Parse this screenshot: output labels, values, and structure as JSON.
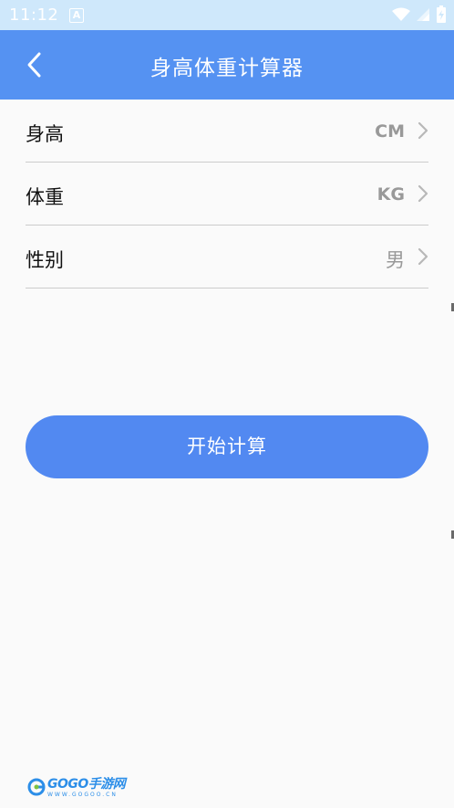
{
  "status_bar": {
    "time": "11:12",
    "notification_letter": "A"
  },
  "app_bar": {
    "title": "身高体重计算器"
  },
  "form": {
    "rows": [
      {
        "label": "身高",
        "value": "CM"
      },
      {
        "label": "体重",
        "value": "KG"
      },
      {
        "label": "性别",
        "value": "男"
      }
    ]
  },
  "actions": {
    "calculate_label": "开始计算"
  },
  "watermark": {
    "text": "GOGO手游网",
    "subtext": "WWW.GOGOO.CN"
  },
  "colors": {
    "app_bar": "#5592f2",
    "status_bar": "#cfe8fb",
    "button": "#5289f1",
    "background": "#fafafa"
  }
}
